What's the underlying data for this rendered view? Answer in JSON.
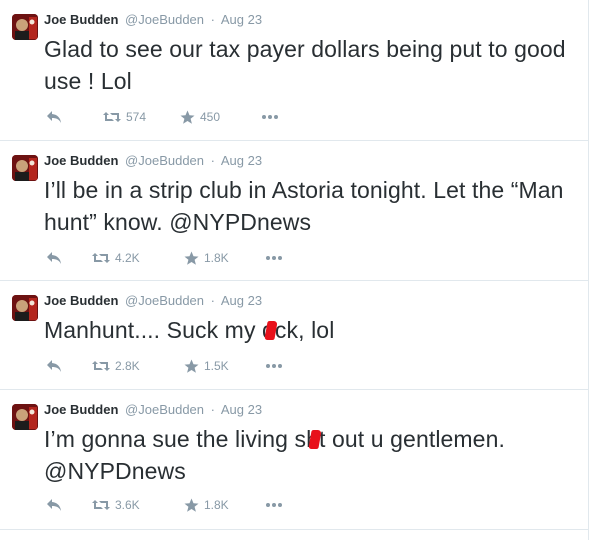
{
  "colors": {
    "text": "#292f33",
    "muted": "#8899a6",
    "divider": "#e1e8ed",
    "redaction": "#e8111b"
  },
  "icons": {
    "reply": "reply-icon",
    "retweet": "retweet-icon",
    "favorite": "star-icon",
    "more": "more-icon"
  },
  "tweets": [
    {
      "fullname": "Joe Budden",
      "username": "@JoeBudden",
      "separator": "·",
      "time": "Aug 23",
      "text": "Glad to see our tax payer dollars being put to good use ! Lol",
      "retweets": "574",
      "favorites": "450"
    },
    {
      "fullname": "Joe Budden",
      "username": "@JoeBudden",
      "separator": "·",
      "time": "Aug 23",
      "text": "I’ll be in a strip club in Astoria tonight. Let the “Man hunt” know. @NYPDnews",
      "retweets": "4.2K",
      "favorites": "1.8K"
    },
    {
      "fullname": "Joe Budden",
      "username": "@JoeBudden",
      "separator": "·",
      "time": "Aug 23",
      "text_a": "Manhunt.... Suck my d",
      "text_b": "ck, lol",
      "retweets": "2.8K",
      "favorites": "1.5K"
    },
    {
      "fullname": "Joe Budden",
      "username": "@JoeBudden",
      "separator": "·",
      "time": "Aug 23",
      "text_a": "I’m gonna sue the living sh",
      "text_b": "t out u gentlemen. @NYPDnews",
      "retweets": "3.6K",
      "favorites": "1.8K"
    }
  ]
}
